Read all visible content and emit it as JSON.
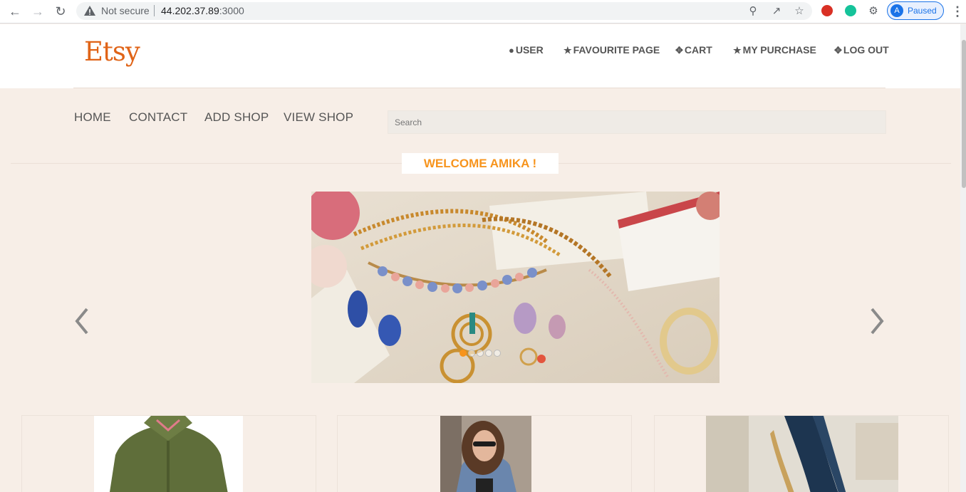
{
  "browser": {
    "security_label": "Not secure",
    "url_host": "44.202.37.89",
    "url_port": ":3000",
    "profile_initial": "A",
    "profile_status": "Paused"
  },
  "site": {
    "logo": "Etsy",
    "top_links": [
      {
        "label": "USER",
        "icon": "user-icon"
      },
      {
        "label": "FAVOURITE PAGE",
        "icon": "star-icon"
      },
      {
        "label": "CART",
        "icon": "crosshair-icon"
      },
      {
        "label": "MY PURCHASE",
        "icon": "star-icon"
      },
      {
        "label": "LOG OUT",
        "icon": "crosshair-icon"
      }
    ],
    "main_nav": [
      "HOME",
      "CONTACT",
      "ADD SHOP",
      "VIEW SHOP"
    ],
    "search_placeholder": "Search",
    "welcome": "WELCOME AMIKA !"
  },
  "carousel": {
    "slide_count": 5,
    "active_index": 0
  },
  "products": [
    {
      "image": "green-fleece-jacket"
    },
    {
      "image": "woman-denim-jacket"
    },
    {
      "image": "navy-high-heel"
    }
  ],
  "colors": {
    "brand": "#e06418",
    "accent": "#f7941d",
    "page_bg": "#f7eee7"
  }
}
